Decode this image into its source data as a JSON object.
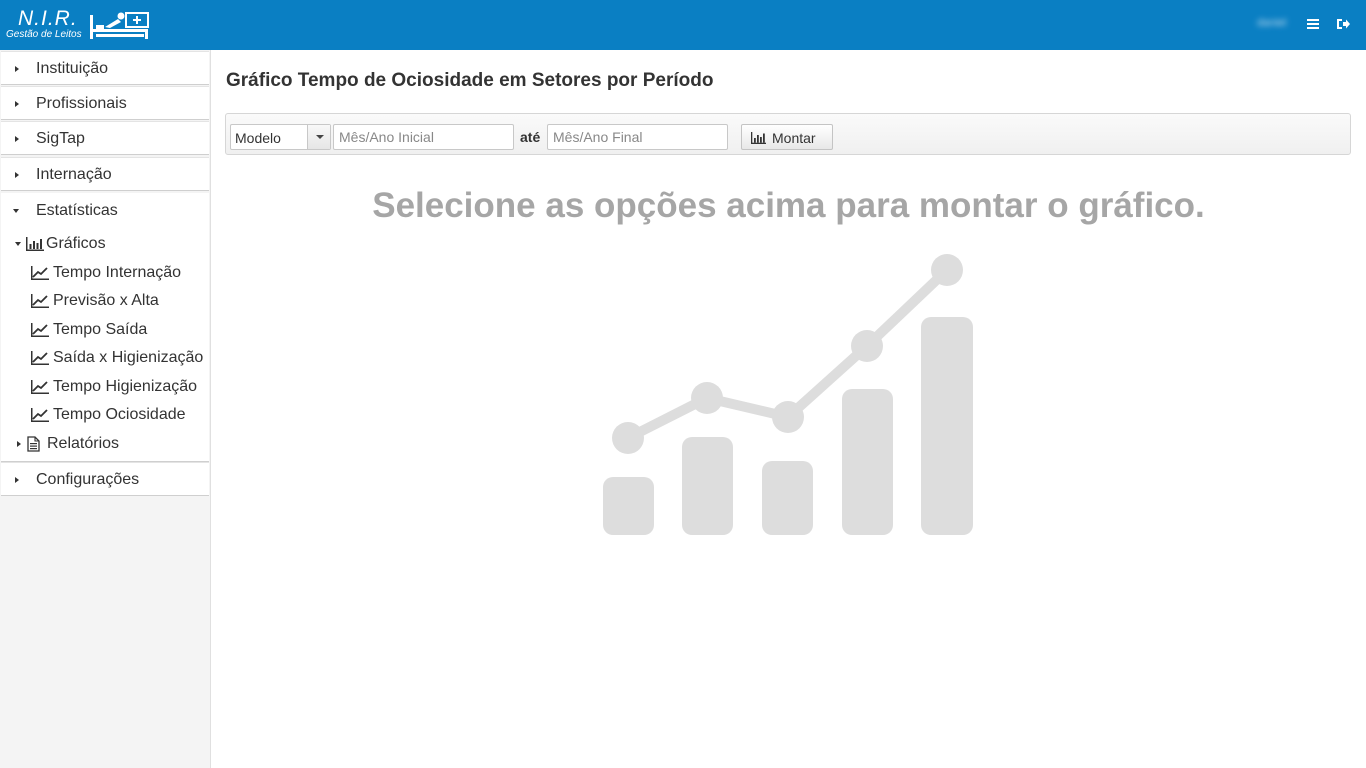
{
  "header": {
    "brand_name": "N.I.R.",
    "brand_subtitle": "Gestão de Leitos",
    "brand_icon": "hospital-bed-icon",
    "user_name": "daniel",
    "menu_icon": "hamburger-icon",
    "logout_icon": "logout-icon",
    "bar_color": "#0a7fc3"
  },
  "sidebar": {
    "items": [
      {
        "label": "Instituição"
      },
      {
        "label": "Profissionais"
      },
      {
        "label": "SigTap"
      },
      {
        "label": "Internação"
      },
      {
        "label": "Estatísticas",
        "expanded": true
      },
      {
        "label": "Configurações"
      }
    ],
    "graficos": {
      "label": "Gráficos",
      "icon": "bar-chart-icon",
      "expanded": true,
      "children": [
        {
          "label": "Tempo Internação",
          "icon": "line-chart-icon"
        },
        {
          "label": "Previsão x Alta",
          "icon": "line-chart-icon"
        },
        {
          "label": "Tempo Saída",
          "icon": "line-chart-icon"
        },
        {
          "label": "Saída x Higienização",
          "icon": "line-chart-icon"
        },
        {
          "label": "Tempo Higienização",
          "icon": "line-chart-icon"
        },
        {
          "label": "Tempo Ociosidade",
          "icon": "line-chart-icon"
        }
      ]
    },
    "relatorios": {
      "label": "Relatórios",
      "icon": "document-icon",
      "expanded": false
    }
  },
  "main": {
    "title": "Gráfico Tempo de Ociosidade em Setores por Período",
    "filters": {
      "model_select_value": "Modelo",
      "start_placeholder": "Mês/Ano Inicial",
      "separator": "até",
      "end_placeholder": "Mês/Ano Final",
      "build_button": "Montar",
      "build_button_icon": "bar-chart-icon"
    },
    "empty_message": "Selecione as opções acima para montar o gráfico.",
    "empty_illustration": "chart-placeholder-icon",
    "illustration_color": "#dddddd"
  }
}
